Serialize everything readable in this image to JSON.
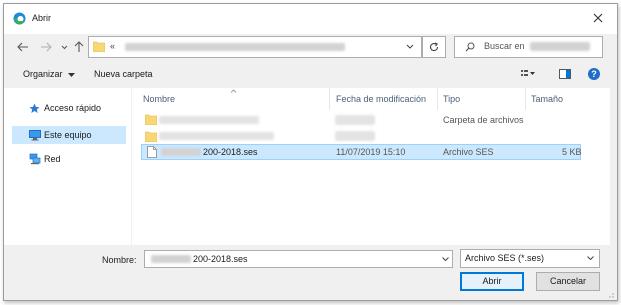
{
  "window": {
    "title": "Abrir"
  },
  "address": {
    "chevrons": "«"
  },
  "search": {
    "placeholder": "Buscar en"
  },
  "toolbar": {
    "organize_label": "Organizar",
    "new_folder_label": "Nueva carpeta"
  },
  "nav": {
    "items": [
      {
        "label": "Acceso rápido"
      },
      {
        "label": "Este equipo"
      },
      {
        "label": "Red"
      }
    ]
  },
  "columns": {
    "name": "Nombre",
    "date": "Fecha de modificación",
    "type": "Tipo",
    "size": "Tamaño"
  },
  "rows": [
    {
      "name": "",
      "date": "",
      "type": "Carpeta de archivos",
      "size": ""
    },
    {
      "name": "",
      "date": "",
      "type": "",
      "size": ""
    },
    {
      "name": "200-2018.ses",
      "date": "11/07/2019 15:10",
      "type": "Archivo SES",
      "size": "5 KB"
    }
  ],
  "footer": {
    "filename_label": "Nombre:",
    "filename_value": "200-2018.ses",
    "filter_value": "Archivo SES (*.ses)",
    "open_label": "Abrir",
    "cancel_label": "Cancelar"
  },
  "colors": {
    "accent": "#0078d7",
    "selection": "#cce8ff",
    "folder": "#f8d775"
  }
}
